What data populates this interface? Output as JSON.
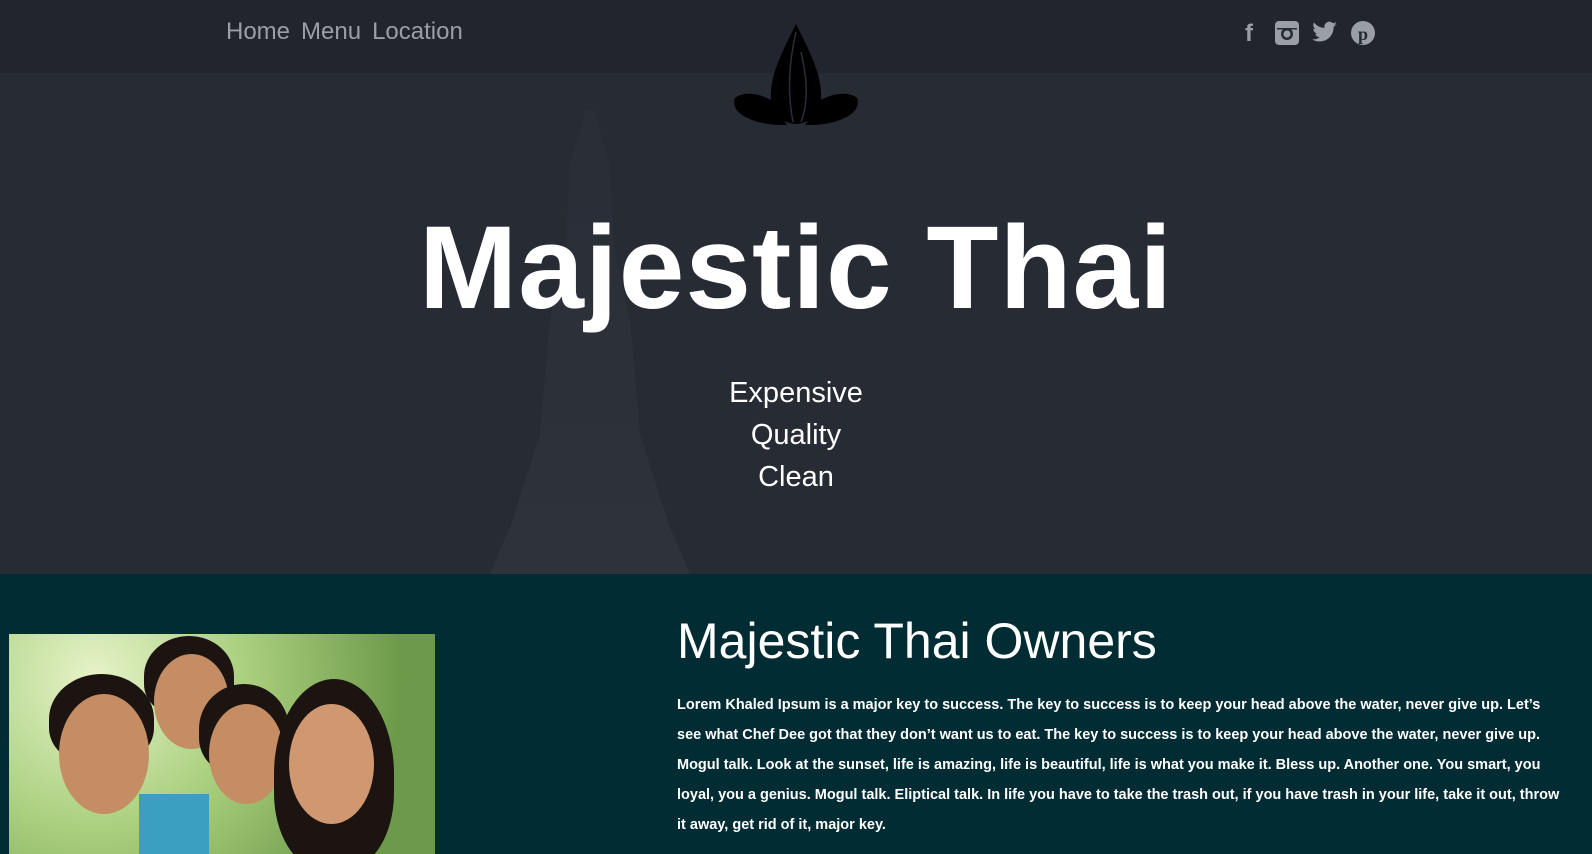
{
  "nav": {
    "items": [
      "Home",
      "Menu",
      "Location"
    ]
  },
  "social": [
    {
      "icon": "facebook-icon",
      "glyph": "f"
    },
    {
      "icon": "instagram-icon",
      "glyph": "◘"
    },
    {
      "icon": "twitter-icon",
      "glyph": "🐦"
    },
    {
      "icon": "pinterest-icon",
      "glyph": "P"
    }
  ],
  "hero": {
    "title": "Majestic Thai",
    "taglines": [
      "Expensive",
      "Quality",
      "Clean"
    ]
  },
  "about": {
    "heading": "Majestic Thai Owners",
    "text": "Lorem Khaled Ipsum is a major key to success. The key to success is to keep your head above the water, never give up. Let’s see what Chef Dee got that they don’t want us to eat. The key to success is to keep your head above the water, never give up. Mogul talk. Look at the sunset, life is amazing, life is beautiful, life is what you make it. Bless up. Another one. You smart, you loyal, you a genius. Mogul talk. Eliptical talk. In life you have to take the trash out, if you have trash in your life, take it out, throw it away, get rid of it, major key."
  }
}
